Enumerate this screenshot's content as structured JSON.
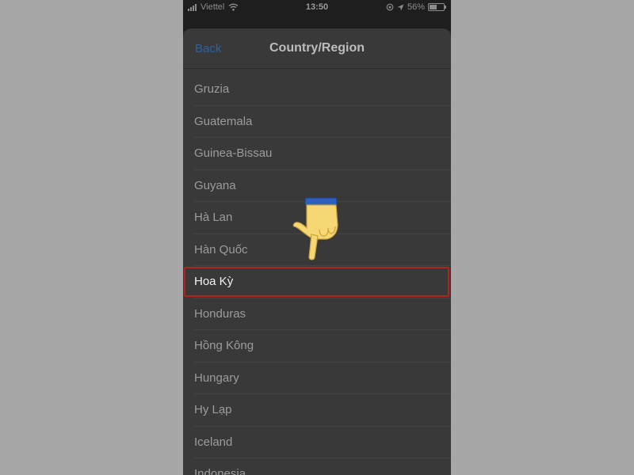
{
  "status_bar": {
    "carrier": "Viettel",
    "time": "13:50",
    "battery": "56%",
    "battery_level": 0.56
  },
  "nav": {
    "back_label": "Back",
    "title": "Country/Region"
  },
  "countries": [
    {
      "label": "Gruzia"
    },
    {
      "label": "Guatemala"
    },
    {
      "label": "Guinea-Bissau"
    },
    {
      "label": "Guyana"
    },
    {
      "label": "Hà Lan"
    },
    {
      "label": "Hàn Quốc"
    },
    {
      "label": "Hoa Kỳ",
      "selected": true
    },
    {
      "label": "Honduras"
    },
    {
      "label": "Hồng Kông"
    },
    {
      "label": "Hungary"
    },
    {
      "label": "Hy Lạp"
    },
    {
      "label": "Iceland"
    },
    {
      "label": "Indonesia"
    }
  ],
  "colors": {
    "accent": "#2c63a0",
    "highlight": "#b3221c",
    "list_background": "#393939"
  },
  "annotations": {
    "pointer_icon": "pointing-hand-icon"
  }
}
